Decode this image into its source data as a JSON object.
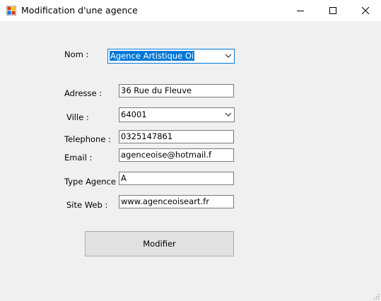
{
  "window": {
    "title": "Modification d'une agence",
    "controls": [
      "minimize-icon",
      "maximize-icon",
      "close-icon"
    ]
  },
  "form": {
    "nom": {
      "label": "Nom :",
      "value": "Agence Artistique Oi"
    },
    "adresse": {
      "label": "Adresse :",
      "value": "36 Rue du Fleuve"
    },
    "ville": {
      "label": "Ville :",
      "value": "64001"
    },
    "telephone": {
      "label": "Telephone :",
      "value": "0325147861"
    },
    "email": {
      "label": "Email :",
      "value": "agenceoise@hotmail.f"
    },
    "type_agence": {
      "label": "Type Agence :",
      "value": "A"
    },
    "site_web": {
      "label": "Site Web :",
      "value": "www.agenceoiseart.fr"
    }
  },
  "actions": {
    "modifier_label": "Modifier"
  },
  "colors": {
    "selection": "#0078d7",
    "background": "#f0f0f0",
    "button": "#e1e1e1"
  }
}
